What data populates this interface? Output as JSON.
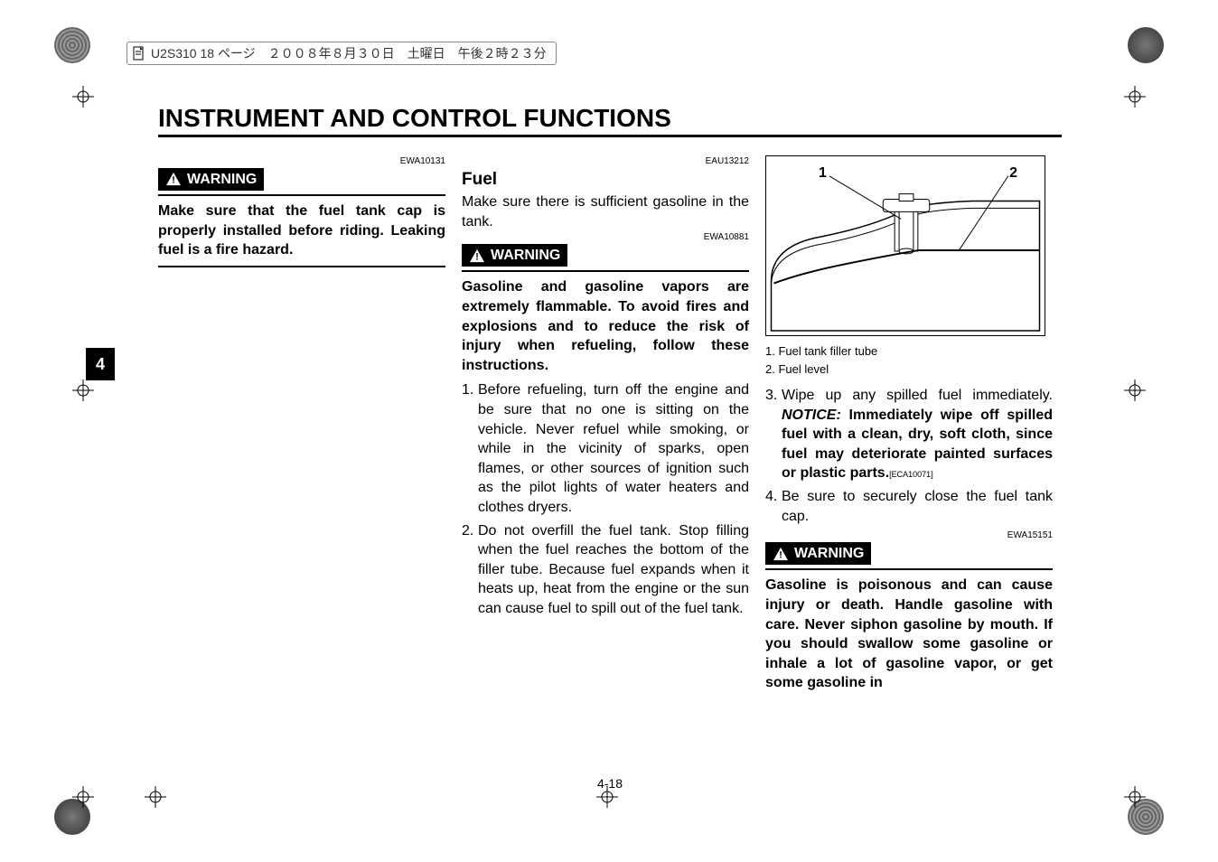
{
  "meta": {
    "header_text": "U2S310  18 ページ　２００８年８月３０日　土曜日　午後２時２３分"
  },
  "page": {
    "title": "INSTRUMENT AND CONTROL FUNCTIONS",
    "side_tab": "4",
    "page_number": "4-18"
  },
  "col1": {
    "code_top": "EWA10131",
    "warning_label": "WARNING",
    "warning_text": "Make sure that the fuel tank cap is properly installed before riding. Leaking fuel is a fire hazard."
  },
  "col2": {
    "code_top": "EAU13212",
    "heading": "Fuel",
    "intro": "Make sure there is sufficient gasoline in the tank.",
    "code_mid": "EWA10881",
    "warning_label": "WARNING",
    "warning_text": "Gasoline and gasoline vapors are extremely flammable. To avoid fires and explosions and to reduce the risk of injury when refueling, follow these instructions.",
    "item1": "Before refueling, turn off the engine and be sure that no one is sitting on the vehicle. Never refuel while smoking, or while in the vicinity of sparks, open flames, or other sources of ignition such as the pilot lights of water heaters and clothes dryers.",
    "item2": "Do not overfill the fuel tank. Stop filling when the fuel reaches the bottom of the filler tube. Because fuel expands when it heats up, heat from the engine or the sun can cause fuel to spill out of the fuel tank."
  },
  "col3": {
    "fig_labels": {
      "l1": "1",
      "l2": "2"
    },
    "caption1": "1. Fuel tank filler tube",
    "caption2": "2. Fuel level",
    "item3_pre": "Wipe up any spilled fuel immediately. ",
    "item3_notice_label": "NOTICE:",
    "item3_notice_text": " Immediately wipe off spilled fuel with a clean, dry, soft cloth, since fuel may deteriorate painted surfaces or plastic parts.",
    "item3_code": "[ECA10071]",
    "item4": "Be sure to securely close the fuel tank cap.",
    "code_bottom": "EWA15151",
    "warning_label": "WARNING",
    "warning_text": "Gasoline is poisonous and can cause injury or death. Handle gasoline with care. Never siphon gasoline by mouth. If you should swallow some gasoline or inhale a lot of gasoline vapor, or get some gasoline in"
  }
}
